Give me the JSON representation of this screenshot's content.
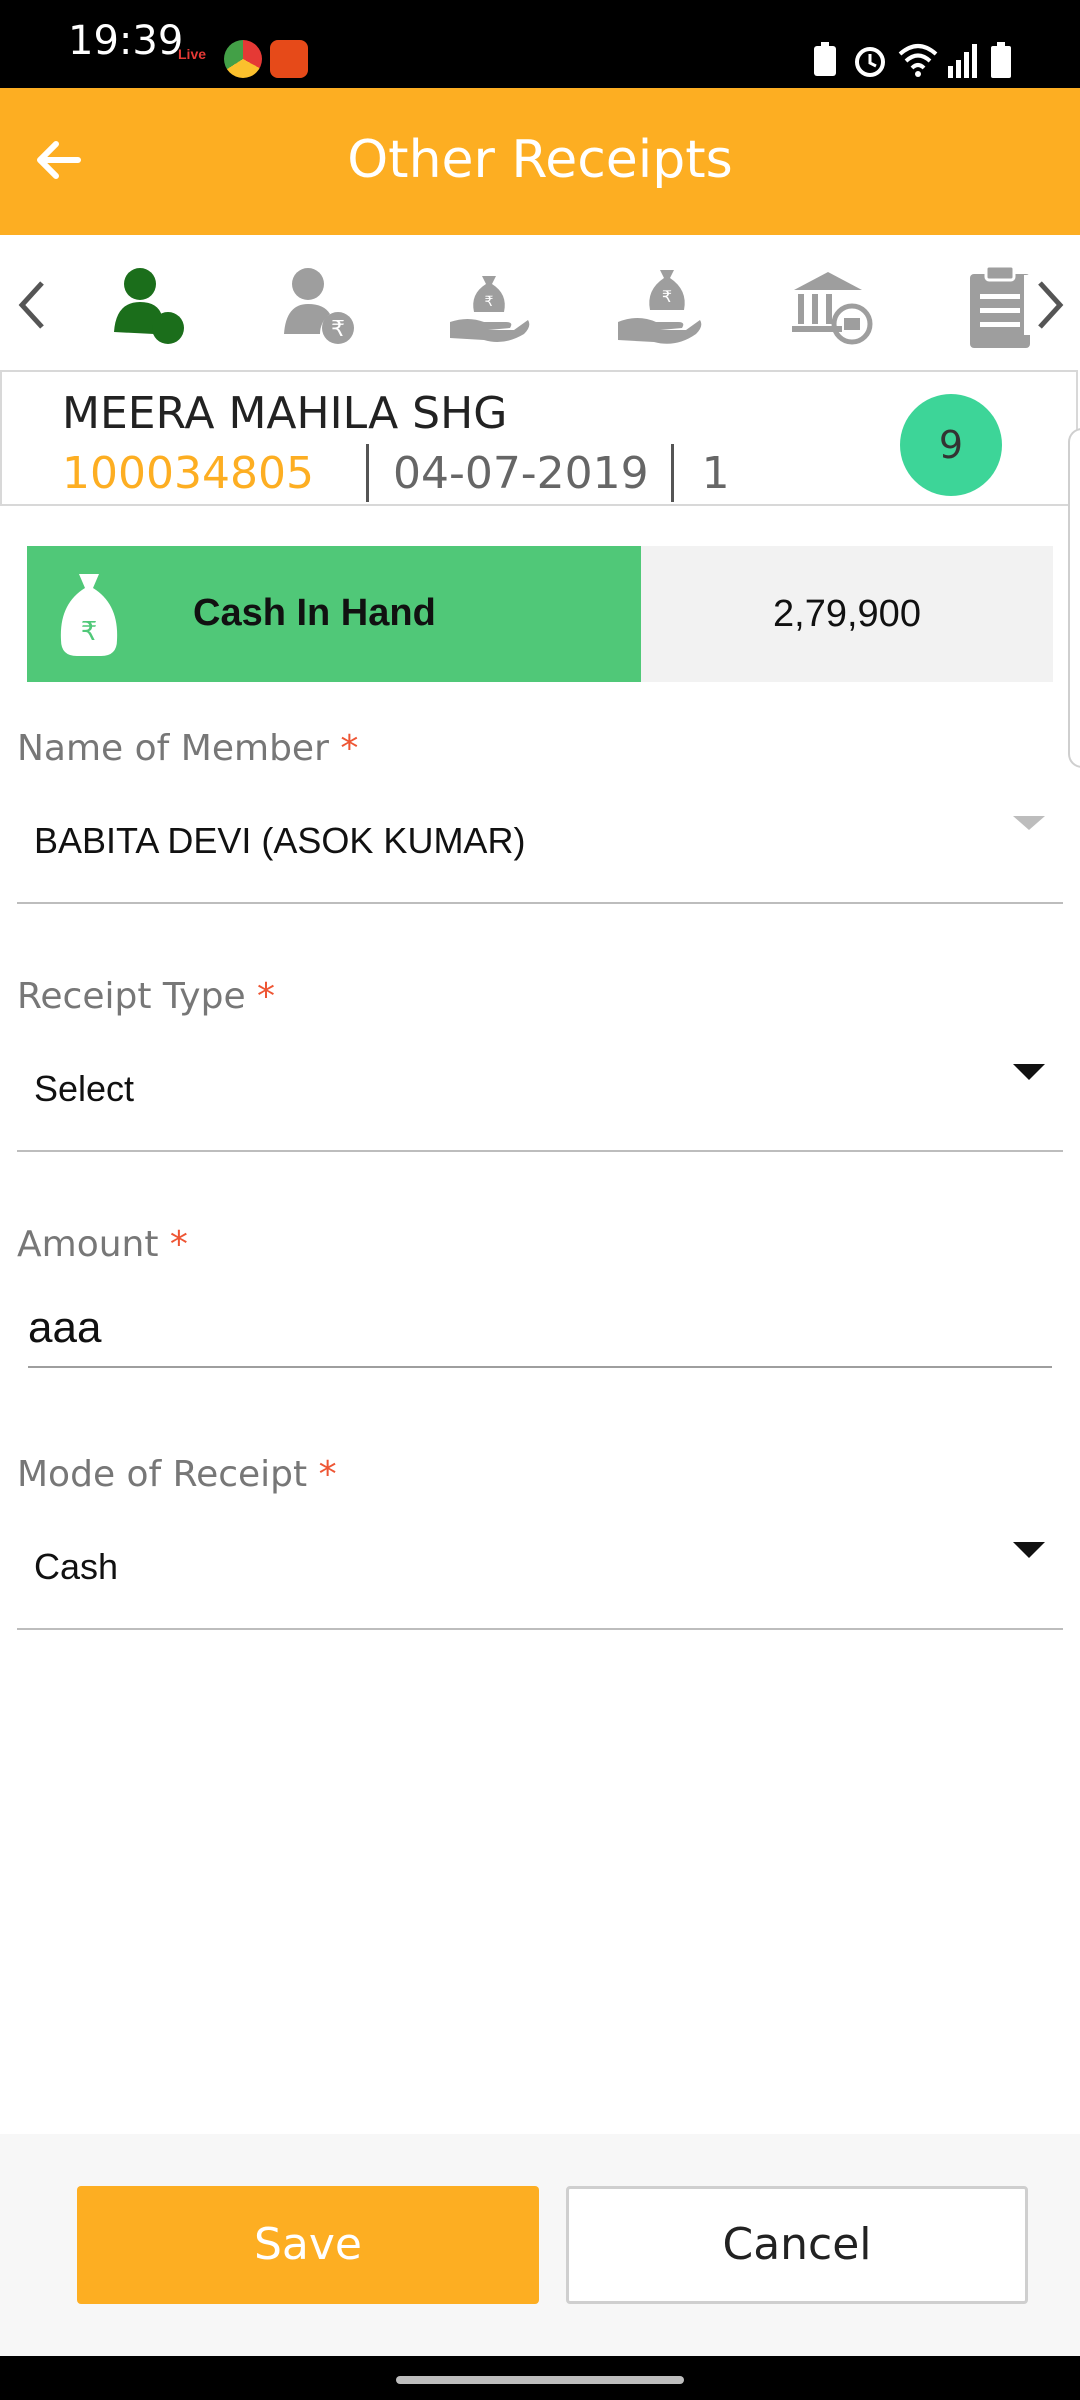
{
  "status_bar": {
    "time": "19:39",
    "live_label": "Live"
  },
  "app_bar": {
    "title": "Other Receipts"
  },
  "tabs": [
    {
      "name": "members-tab",
      "active": true
    },
    {
      "name": "member-payment-tab",
      "active": false
    },
    {
      "name": "receipt-bag-tab",
      "active": false
    },
    {
      "name": "hand-money-tab",
      "active": false
    },
    {
      "name": "bank-tab",
      "active": false
    },
    {
      "name": "clipboard-tab",
      "active": false
    }
  ],
  "group_card": {
    "name": "MEERA MAHILA SHG",
    "id": "100034805",
    "date": "04-07-2019",
    "meeting_no": "1",
    "badge_count": "9"
  },
  "cash_in_hand": {
    "label": "Cash In Hand",
    "amount": "2,79,900",
    "currency_symbol": "₹"
  },
  "form": {
    "member": {
      "label": "Name of Member",
      "required_mark": "*",
      "value": "BABITA DEVI (ASOK KUMAR)"
    },
    "receipt_type": {
      "label": "Receipt Type",
      "required_mark": "*",
      "value": "Select"
    },
    "amount": {
      "label": "Amount",
      "required_mark": "*",
      "value": "aaa"
    },
    "mode": {
      "label": "Mode of Receipt",
      "required_mark": "*",
      "value": "Cash"
    }
  },
  "footer": {
    "save_label": "Save",
    "cancel_label": "Cancel"
  },
  "colors": {
    "primary": "#FDAE22",
    "accent_green": "#50C878",
    "badge_green": "#3DD598",
    "active_icon": "#1b6e1b",
    "inactive_icon": "#9e9e9e"
  }
}
